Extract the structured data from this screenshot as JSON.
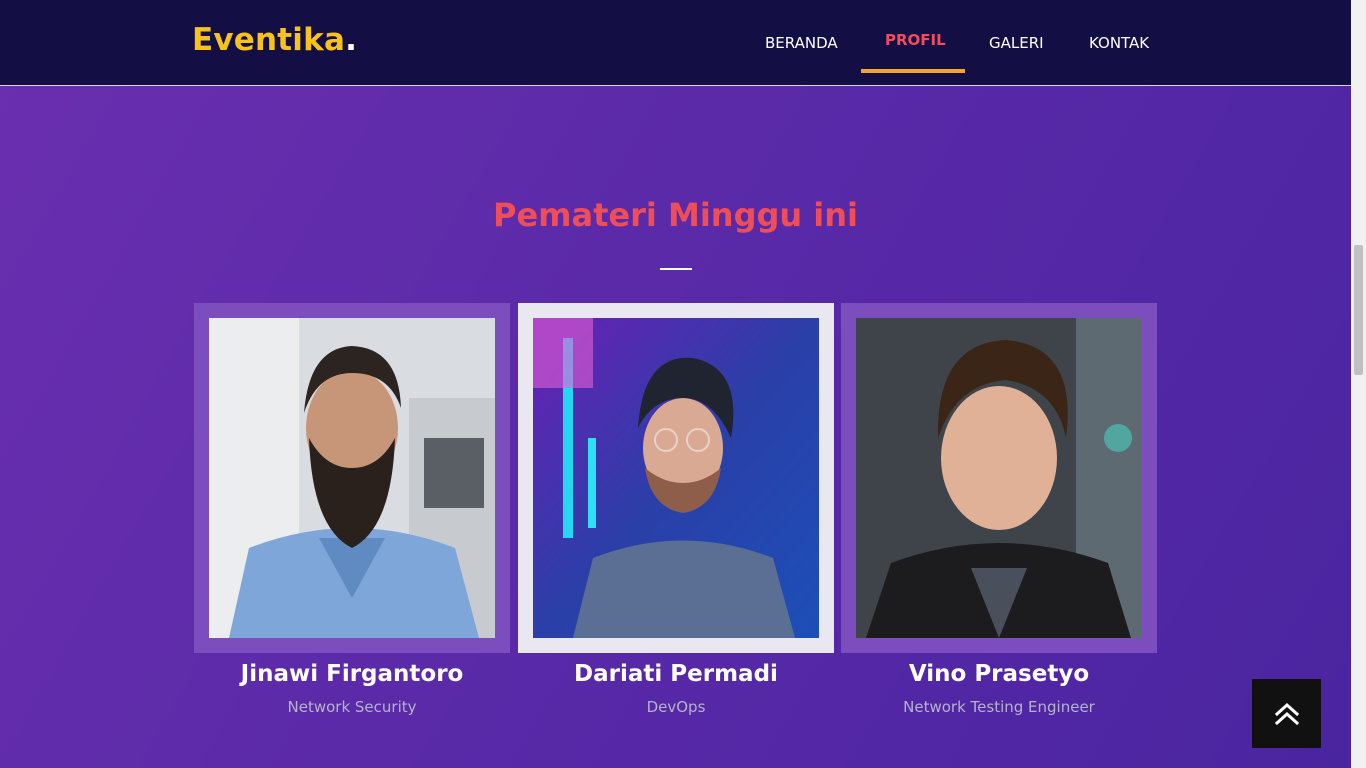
{
  "header": {
    "brand": "Eventika",
    "brand_dot": ".",
    "nav": [
      {
        "label": "BERANDA",
        "active": false
      },
      {
        "label": "PROFIL",
        "active": true
      },
      {
        "label": "GALERI",
        "active": false
      },
      {
        "label": "KONTAK",
        "active": false
      }
    ]
  },
  "section": {
    "title": "Pemateri Minggu ini"
  },
  "speakers": [
    {
      "name": "Jinawi Firgantoro",
      "role": "Network Security"
    },
    {
      "name": "Dariati Permadi",
      "role": "DevOps"
    },
    {
      "name": "Vino Prasetyo",
      "role": "Network Testing Engineer"
    }
  ],
  "icons": {
    "back_to_top": "double-chevron-up-icon"
  },
  "colors": {
    "navbar_bg": "#130f45",
    "brand": "#f8c21c",
    "active_nav": "#f14d5d",
    "active_underline": "#f5a623",
    "section_title": "#f04e57",
    "page_bg": "#5a2aa8"
  }
}
